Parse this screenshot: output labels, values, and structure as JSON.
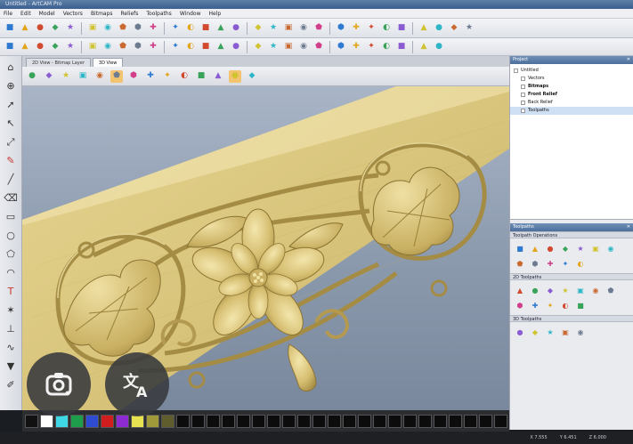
{
  "window": {
    "title": "Untitled - ArtCAM Pro"
  },
  "menu": [
    "File",
    "Edit",
    "Model",
    "Vectors",
    "Bitmaps",
    "Reliefs",
    "Toolpaths",
    "Window",
    "Help"
  ],
  "toolbar1": {
    "icons": [
      "new-file",
      "open-file",
      "save-file",
      "cut",
      "copy",
      "paste",
      "undo",
      "redo",
      "print",
      "paint-bucket",
      "3d-view",
      "bitmap-colors",
      "import",
      "export",
      "globe",
      "relief-edit",
      "magnet",
      "grid",
      "measure",
      "snap",
      "link",
      "move",
      "scale",
      "rotate",
      "mirror",
      "text-tool",
      "relief-sculpt",
      "shield",
      "layers"
    ]
  },
  "toolbar2": {
    "icons": [
      "select",
      "node-edit",
      "star",
      "polygon",
      "circle",
      "ellipse",
      "arc",
      "bezier",
      "spline",
      "trim",
      "fillet",
      "offset",
      "group",
      "ungroup",
      "align",
      "weld",
      "subtract",
      "intersect",
      "array",
      "nest",
      "transform",
      "vector-doctor",
      "smooth",
      "break",
      "join",
      "close",
      "extend"
    ]
  },
  "left_tools": [
    "home",
    "globe",
    "select",
    "node",
    "transform",
    "pen",
    "brush",
    "eraser",
    "rect",
    "circle",
    "polygon",
    "arc",
    "text",
    "star",
    "chisel",
    "bezier",
    "gradient",
    "dropper"
  ],
  "view_tabs": [
    {
      "label": "2D View - Bitmap Layer",
      "active": false
    },
    {
      "label": "3D View",
      "active": true
    }
  ],
  "view_tools": [
    "3d-iso",
    "zoom-fit",
    "light",
    "rotate-view",
    "shaded",
    "flip",
    "mirror-view",
    "solid",
    "grid",
    "smooth-view",
    "invert",
    "material",
    "color-preview",
    "texture"
  ],
  "project": {
    "header": "Project",
    "items": [
      {
        "label": "Untitled",
        "bold": false,
        "selected": false
      },
      {
        "label": "Vectors",
        "bold": false,
        "selected": false
      },
      {
        "label": "Bitmaps",
        "bold": true,
        "selected": false
      },
      {
        "label": "Front Relief",
        "bold": true,
        "selected": false
      },
      {
        "label": "Back Relief",
        "bold": false,
        "selected": false
      },
      {
        "label": "Toolpaths",
        "bold": false,
        "selected": true
      }
    ]
  },
  "toolpaths": {
    "header": "Toolpaths",
    "sections": [
      {
        "title": "Toolpath Operations",
        "count": 12
      },
      {
        "title": "2D Toolpaths",
        "count": 12
      },
      {
        "title": "3D Toolpaths",
        "count": 5
      }
    ]
  },
  "palette": [
    "#111111",
    "#ffffff",
    "#3fd6e6",
    "#1e9e4a",
    "#2f4bd1",
    "#d01d1d",
    "#8b2bd1",
    "#e7e252",
    "#a09a3a",
    "#5f5c2e",
    "#0c0c0c",
    "#0c0c0c",
    "#0c0c0c",
    "#0c0c0c",
    "#0c0c0c",
    "#0c0c0c",
    "#0c0c0c",
    "#0c0c0c",
    "#0c0c0c",
    "#0c0c0c",
    "#0c0c0c",
    "#0c0c0c",
    "#0c0c0c",
    "#0c0c0c",
    "#0c0c0c",
    "#0c0c0c",
    "#0c0c0c",
    "#0c0c0c",
    "#0c0c0c",
    "#0c0c0c",
    "#0c0c0c",
    "#0c0c0c"
  ],
  "status": {
    "x": "X 7.555",
    "y": "Y 6.451",
    "z": "Z 6.000"
  },
  "overlay": {
    "lens_icon": "google-lens-icon",
    "translate_icon": "translate-icon"
  },
  "colors": {
    "relief": "#d8c27a",
    "relief_shadow": "#9c843d",
    "background": "#93a0b3",
    "accent": "#4d6f9b"
  }
}
